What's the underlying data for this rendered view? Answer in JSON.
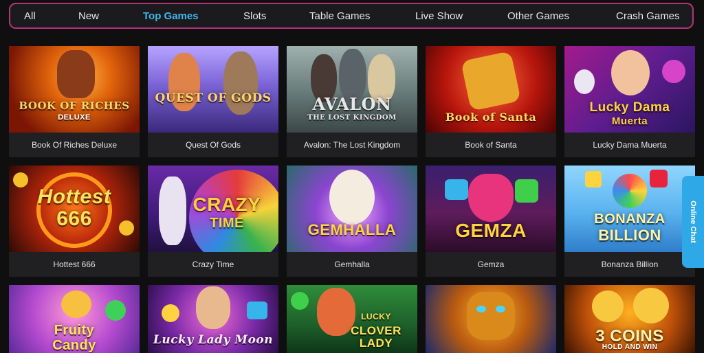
{
  "nav": {
    "tabs": [
      {
        "label": "All"
      },
      {
        "label": "New"
      },
      {
        "label": "Top Games",
        "active": true
      },
      {
        "label": "Slots"
      },
      {
        "label": "Table Games"
      },
      {
        "label": "Live Show"
      },
      {
        "label": "Other Games"
      },
      {
        "label": "Crash Games"
      }
    ]
  },
  "games": [
    {
      "title": "Book Of Riches Deluxe",
      "logo": "BOOK OF RICHES",
      "sub": "DELUXE"
    },
    {
      "title": "Quest Of Gods",
      "logo": "QUEST OF GODS",
      "sub": ""
    },
    {
      "title": "Avalon: The Lost Kingdom",
      "logo": "AVALON",
      "sub": "THE LOST KINGDOM"
    },
    {
      "title": "Book of Santa",
      "logo": "Book of Santa",
      "sub": ""
    },
    {
      "title": "Lucky Dama Muerta",
      "logo": "Lucky Dama",
      "sub": "Muerta"
    },
    {
      "title": "Hottest 666",
      "logo": "Hottest",
      "sub": "666"
    },
    {
      "title": "Crazy Time",
      "logo": "CRAZY",
      "sub": "TIME"
    },
    {
      "title": "Gemhalla",
      "logo": "GEMHALLA",
      "sub": ""
    },
    {
      "title": "Gemza",
      "logo": "GEMZA",
      "sub": ""
    },
    {
      "title": "Bonanza Billion",
      "logo": "BONANZA",
      "sub": "BILLION"
    },
    {
      "title": "",
      "logo": "Fruity",
      "sub": "Candy"
    },
    {
      "title": "",
      "logo": "Lucky Lady Moon",
      "sub": ""
    },
    {
      "title": "",
      "logo": "LUCKY",
      "sub": "CLOVER LADY"
    },
    {
      "title": "",
      "logo": "",
      "sub": ""
    },
    {
      "title": "",
      "logo": "3 COINS",
      "sub": "HOLD AND WIN"
    }
  ],
  "chat": {
    "label": "Online Chat"
  },
  "colors": {
    "accent": "#3fb6f0",
    "nav_border": "#b4337a",
    "chat": "#2fa8e8"
  }
}
